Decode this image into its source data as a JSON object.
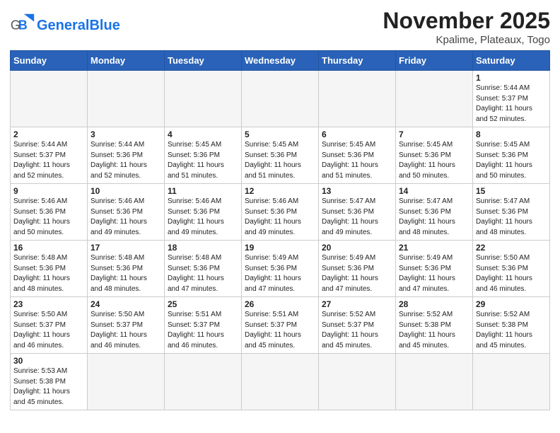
{
  "header": {
    "logo_general": "General",
    "logo_blue": "Blue",
    "month_title": "November 2025",
    "location": "Kpalime, Plateaux, Togo"
  },
  "weekdays": [
    "Sunday",
    "Monday",
    "Tuesday",
    "Wednesday",
    "Thursday",
    "Friday",
    "Saturday"
  ],
  "weeks": [
    [
      {
        "day": "",
        "info": ""
      },
      {
        "day": "",
        "info": ""
      },
      {
        "day": "",
        "info": ""
      },
      {
        "day": "",
        "info": ""
      },
      {
        "day": "",
        "info": ""
      },
      {
        "day": "",
        "info": ""
      },
      {
        "day": "1",
        "info": "Sunrise: 5:44 AM\nSunset: 5:37 PM\nDaylight: 11 hours\nand 52 minutes."
      }
    ],
    [
      {
        "day": "2",
        "info": "Sunrise: 5:44 AM\nSunset: 5:37 PM\nDaylight: 11 hours\nand 52 minutes."
      },
      {
        "day": "3",
        "info": "Sunrise: 5:44 AM\nSunset: 5:36 PM\nDaylight: 11 hours\nand 52 minutes."
      },
      {
        "day": "4",
        "info": "Sunrise: 5:45 AM\nSunset: 5:36 PM\nDaylight: 11 hours\nand 51 minutes."
      },
      {
        "day": "5",
        "info": "Sunrise: 5:45 AM\nSunset: 5:36 PM\nDaylight: 11 hours\nand 51 minutes."
      },
      {
        "day": "6",
        "info": "Sunrise: 5:45 AM\nSunset: 5:36 PM\nDaylight: 11 hours\nand 51 minutes."
      },
      {
        "day": "7",
        "info": "Sunrise: 5:45 AM\nSunset: 5:36 PM\nDaylight: 11 hours\nand 50 minutes."
      },
      {
        "day": "8",
        "info": "Sunrise: 5:45 AM\nSunset: 5:36 PM\nDaylight: 11 hours\nand 50 minutes."
      }
    ],
    [
      {
        "day": "9",
        "info": "Sunrise: 5:46 AM\nSunset: 5:36 PM\nDaylight: 11 hours\nand 50 minutes."
      },
      {
        "day": "10",
        "info": "Sunrise: 5:46 AM\nSunset: 5:36 PM\nDaylight: 11 hours\nand 49 minutes."
      },
      {
        "day": "11",
        "info": "Sunrise: 5:46 AM\nSunset: 5:36 PM\nDaylight: 11 hours\nand 49 minutes."
      },
      {
        "day": "12",
        "info": "Sunrise: 5:46 AM\nSunset: 5:36 PM\nDaylight: 11 hours\nand 49 minutes."
      },
      {
        "day": "13",
        "info": "Sunrise: 5:47 AM\nSunset: 5:36 PM\nDaylight: 11 hours\nand 49 minutes."
      },
      {
        "day": "14",
        "info": "Sunrise: 5:47 AM\nSunset: 5:36 PM\nDaylight: 11 hours\nand 48 minutes."
      },
      {
        "day": "15",
        "info": "Sunrise: 5:47 AM\nSunset: 5:36 PM\nDaylight: 11 hours\nand 48 minutes."
      }
    ],
    [
      {
        "day": "16",
        "info": "Sunrise: 5:48 AM\nSunset: 5:36 PM\nDaylight: 11 hours\nand 48 minutes."
      },
      {
        "day": "17",
        "info": "Sunrise: 5:48 AM\nSunset: 5:36 PM\nDaylight: 11 hours\nand 48 minutes."
      },
      {
        "day": "18",
        "info": "Sunrise: 5:48 AM\nSunset: 5:36 PM\nDaylight: 11 hours\nand 47 minutes."
      },
      {
        "day": "19",
        "info": "Sunrise: 5:49 AM\nSunset: 5:36 PM\nDaylight: 11 hours\nand 47 minutes."
      },
      {
        "day": "20",
        "info": "Sunrise: 5:49 AM\nSunset: 5:36 PM\nDaylight: 11 hours\nand 47 minutes."
      },
      {
        "day": "21",
        "info": "Sunrise: 5:49 AM\nSunset: 5:36 PM\nDaylight: 11 hours\nand 47 minutes."
      },
      {
        "day": "22",
        "info": "Sunrise: 5:50 AM\nSunset: 5:36 PM\nDaylight: 11 hours\nand 46 minutes."
      }
    ],
    [
      {
        "day": "23",
        "info": "Sunrise: 5:50 AM\nSunset: 5:37 PM\nDaylight: 11 hours\nand 46 minutes."
      },
      {
        "day": "24",
        "info": "Sunrise: 5:50 AM\nSunset: 5:37 PM\nDaylight: 11 hours\nand 46 minutes."
      },
      {
        "day": "25",
        "info": "Sunrise: 5:51 AM\nSunset: 5:37 PM\nDaylight: 11 hours\nand 46 minutes."
      },
      {
        "day": "26",
        "info": "Sunrise: 5:51 AM\nSunset: 5:37 PM\nDaylight: 11 hours\nand 45 minutes."
      },
      {
        "day": "27",
        "info": "Sunrise: 5:52 AM\nSunset: 5:37 PM\nDaylight: 11 hours\nand 45 minutes."
      },
      {
        "day": "28",
        "info": "Sunrise: 5:52 AM\nSunset: 5:38 PM\nDaylight: 11 hours\nand 45 minutes."
      },
      {
        "day": "29",
        "info": "Sunrise: 5:52 AM\nSunset: 5:38 PM\nDaylight: 11 hours\nand 45 minutes."
      }
    ],
    [
      {
        "day": "30",
        "info": "Sunrise: 5:53 AM\nSunset: 5:38 PM\nDaylight: 11 hours\nand 45 minutes."
      },
      {
        "day": "",
        "info": ""
      },
      {
        "day": "",
        "info": ""
      },
      {
        "day": "",
        "info": ""
      },
      {
        "day": "",
        "info": ""
      },
      {
        "day": "",
        "info": ""
      },
      {
        "day": "",
        "info": ""
      }
    ]
  ]
}
